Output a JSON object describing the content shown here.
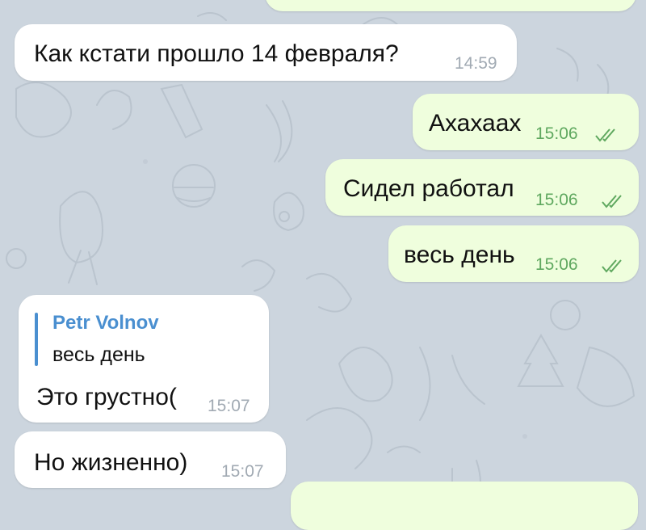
{
  "chat": {
    "messages": [
      {
        "direction": "in",
        "text": "Как кстати прошло 14 февраля?",
        "time": "14:59"
      },
      {
        "direction": "out",
        "text": "Ахахаах",
        "time": "15:06",
        "status": "read-double-check-icon"
      },
      {
        "direction": "out",
        "text": "Сидел работал",
        "time": "15:06",
        "status": "read-double-check-icon"
      },
      {
        "direction": "out",
        "text": "весь день",
        "time": "15:06",
        "status": "read-double-check-icon"
      },
      {
        "direction": "in",
        "reply": {
          "author": "Petr Volnov",
          "text": "весь день"
        },
        "text": "Это грустно(",
        "time": "15:07"
      },
      {
        "direction": "in",
        "text": "Но жизненно)",
        "time": "15:07"
      }
    ]
  },
  "colors": {
    "background": "#ccd5de",
    "incoming_bubble": "#ffffff",
    "outgoing_bubble": "#effedd",
    "reply_accent": "#4a8fd0",
    "outgoing_time": "#5fa85f",
    "incoming_time": "#a1aab3"
  }
}
